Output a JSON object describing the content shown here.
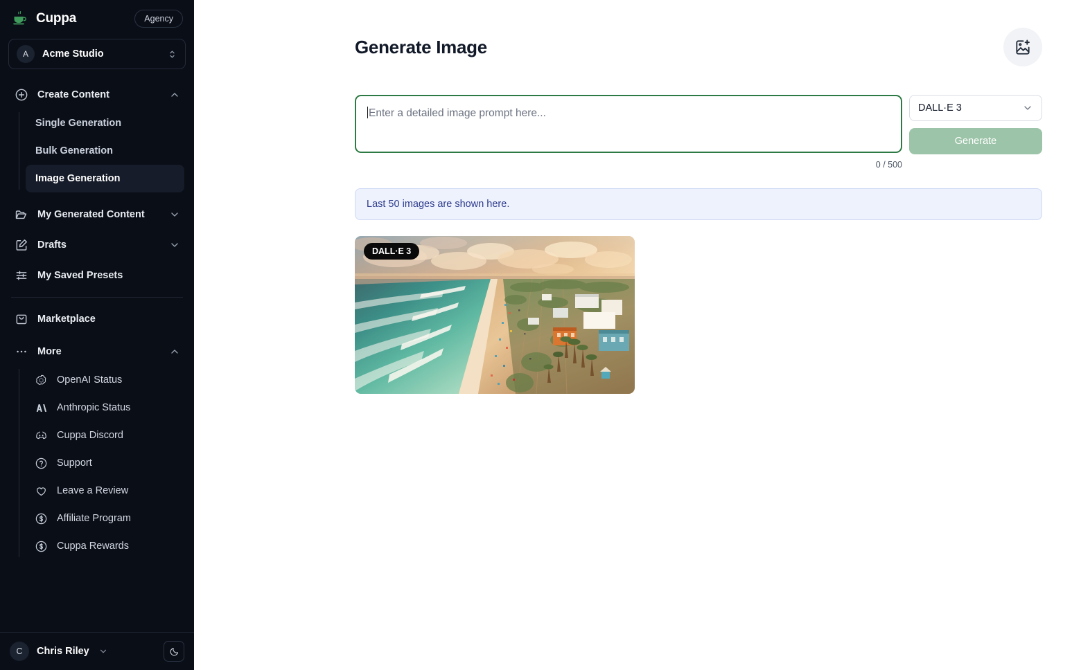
{
  "sidebar": {
    "brand": {
      "name": "Cuppa",
      "logo_icon": "coffee-cup-icon",
      "badge": "Agency"
    },
    "org": {
      "avatar_initial": "A",
      "name": "Acme Studio",
      "caret_icon": "chevron-updown-icon"
    },
    "create_content": {
      "label": "Create Content",
      "icon": "plus-circle-icon",
      "chevron": "chevron-up-icon",
      "items": [
        {
          "label": "Single Generation",
          "active": false
        },
        {
          "label": "Bulk Generation",
          "active": false
        },
        {
          "label": "Image Generation",
          "active": true
        }
      ]
    },
    "items": [
      {
        "label": "My Generated Content",
        "icon": "folder-open-icon",
        "chevron": "chevron-down-icon"
      },
      {
        "label": "Drafts",
        "icon": "pencil-square-icon",
        "chevron": "chevron-down-icon"
      },
      {
        "label": "My Saved Presets",
        "icon": "sliders-icon",
        "chevron": ""
      },
      {
        "label": "Marketplace",
        "icon": "shopping-bag-icon",
        "chevron": ""
      }
    ],
    "more": {
      "label": "More",
      "icon": "ellipsis-icon",
      "chevron": "chevron-up-icon",
      "items": [
        {
          "label": "OpenAI Status",
          "icon": "openai-icon"
        },
        {
          "label": "Anthropic Status",
          "icon": "anthropic-icon"
        },
        {
          "label": "Cuppa Discord",
          "icon": "discord-icon"
        },
        {
          "label": "Support",
          "icon": "question-circle-icon"
        },
        {
          "label": "Leave a Review",
          "icon": "heart-icon"
        },
        {
          "label": "Affiliate Program",
          "icon": "dollar-circle-icon"
        },
        {
          "label": "Cuppa Rewards",
          "icon": "dollar-circle-icon"
        }
      ]
    },
    "footer": {
      "avatar_initial": "C",
      "user_name": "Chris Riley",
      "caret_icon": "chevron-down-icon",
      "theme_toggle_icon": "moon-icon"
    }
  },
  "main": {
    "title": "Generate Image",
    "header_action_icon": "image-plus-icon",
    "prompt": {
      "value": "",
      "placeholder": "Enter a detailed image prompt here..."
    },
    "model_select": {
      "value": "DALL·E 3",
      "chevron_icon": "chevron-down-icon"
    },
    "generate_button": {
      "label": "Generate",
      "disabled": true
    },
    "counter": "0 / 500",
    "info_banner": "Last 50 images are shown here.",
    "gallery": [
      {
        "badge": "DALL·E 3",
        "alt": "Aerial view of a beach coastline at golden hour with turquoise waves, sandy shore, palm trees and resort buildings"
      }
    ]
  },
  "colors": {
    "sidebar_bg": "#0a0e17",
    "accent_green": "#2d7a44",
    "generate_btn": "#9cc4a8",
    "info_bg": "#eef2fd",
    "info_text": "#2c3a8c"
  }
}
